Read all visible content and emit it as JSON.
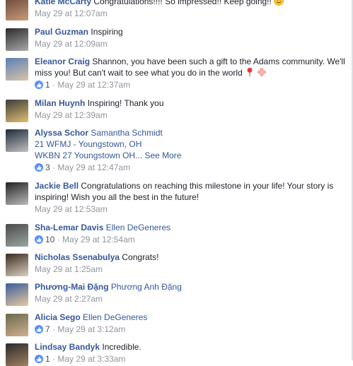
{
  "comments": [
    {
      "name": "Katie McCarty",
      "text": "Congratulations!!!! So impressed!! Keep going!!",
      "time": "May 29 at 12:07am",
      "likes": "",
      "avatar_colors": [
        "#6b4a3a",
        "#c99b7a"
      ]
    },
    {
      "name": "Paul Guzman",
      "text": "Inspiring",
      "time": "May 29 at 12:09am",
      "likes": "",
      "avatar_colors": [
        "#2b2b2b",
        "#a9a9a9"
      ]
    },
    {
      "name": "Eleanor Craig",
      "text": "Shannon, you have been such a gift to the Adams community. We'll miss you! But can't wait to see what you do in the world",
      "time": "May 29 at 12:37am",
      "likes": "1",
      "avatar_colors": [
        "#5b7fb8",
        "#d9c3a5"
      ]
    },
    {
      "name": "Milan Huynh",
      "text": "Inspiring! Thank you",
      "time": "May 29 at 12:39am",
      "likes": "",
      "avatar_colors": [
        "#3b3b3b",
        "#e0c070"
      ]
    },
    {
      "name": "Alyssa Schor",
      "tag": "Samantha Schmidt",
      "line2": "21 WFMJ - Youngstown, OH",
      "line3": "WKBN 27 Youngstown OH...",
      "see_more": "See More",
      "time": "May 29 at 12:47am",
      "likes": "3",
      "avatar_colors": [
        "#1e2a3a",
        "#c0c0c0"
      ]
    },
    {
      "name": "Jackie Bell",
      "text": "Congratulations on reaching this milestone in your life! Your story is inspiring! Wish you all the best in the future!",
      "time": "May 29 at 12:53am",
      "likes": "",
      "avatar_colors": [
        "#222222",
        "#bbbbbb"
      ]
    },
    {
      "name": "Sha-Lemar Davis",
      "tag": "Ellen DeGeneres",
      "time": "May 29 at 12:54am",
      "likes": "10",
      "avatar_colors": [
        "#4a4a4a",
        "#9aa5a0"
      ]
    },
    {
      "name": "Nicholas Ssenabulya",
      "text": "Congrats!",
      "time": "May 29 at 1:25am",
      "likes": "",
      "avatar_colors": [
        "#3a2a20",
        "#d8d0c0"
      ]
    },
    {
      "name": "Phương-Mai Đặng",
      "tag": "Phương Anh Đặng",
      "time": "May 29 at 2:27am",
      "likes": "",
      "avatar_colors": [
        "#3b5d9a",
        "#e7c9a0"
      ]
    },
    {
      "name": "Alicia Sego",
      "tag": "Ellen DeGeneres",
      "time": "May 29 at 3:12am",
      "likes": "7",
      "avatar_colors": [
        "#6a6a4a",
        "#d0b090"
      ]
    },
    {
      "name": "Lindsay Bandyk",
      "text": "Incredible.",
      "time": "May 29 at 3:33am",
      "likes": "1",
      "avatar_colors": [
        "#2a2a2a",
        "#a08060"
      ]
    }
  ],
  "colors": {
    "name": "#365899",
    "meta": "#90949c",
    "like": "#5890ff"
  }
}
